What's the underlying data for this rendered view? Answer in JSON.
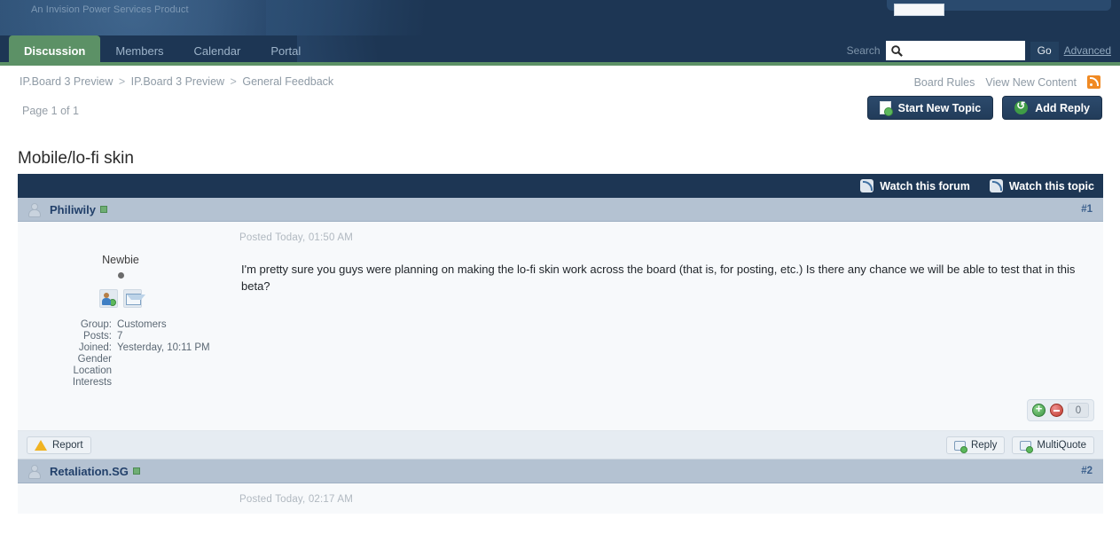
{
  "header": {
    "tagline": "An Invision Power Services Product"
  },
  "nav": {
    "tabs": [
      {
        "label": "Discussion",
        "active": true
      },
      {
        "label": "Members",
        "active": false
      },
      {
        "label": "Calendar",
        "active": false
      },
      {
        "label": "Portal",
        "active": false
      }
    ],
    "search": {
      "label": "Search",
      "value": "",
      "placeholder": "",
      "icon": "search-icon",
      "go_label": "Go",
      "advanced_label": "Advanced"
    }
  },
  "breadcrumb": {
    "items": [
      "IP.Board 3 Preview",
      "IP.Board 3 Preview",
      "General Feedback"
    ],
    "separator": ">"
  },
  "header_links": {
    "board_rules": "Board Rules",
    "view_new_content": "View New Content",
    "rss_icon": "rss-icon"
  },
  "page": {
    "page_info": "Page 1 of 1",
    "topic_title": "Mobile/lo-fi skin",
    "buttons": [
      {
        "label": "Start New Topic",
        "icon": "new-topic-icon"
      },
      {
        "label": "Add Reply",
        "icon": "reply-arrow-icon"
      }
    ]
  },
  "watch_bar": {
    "watch_forum": "Watch this forum",
    "watch_topic": "Watch this topic"
  },
  "posts": [
    {
      "author": "Philiwily",
      "number": "#1",
      "date": "Posted Today, 01:50 AM",
      "text": "I'm pretty sure you guys were planning on making the lo-fi skin work across the board (that is, for posting, etc.) Is there any chance we will be able to test that in this beta?",
      "rank": "Newbie",
      "fields": [
        {
          "label": "Group:",
          "value": "Customers"
        },
        {
          "label": "Posts:",
          "value": "7"
        },
        {
          "label": "Joined:",
          "value": "Yesterday, 10:11 PM"
        },
        {
          "label": "Gender",
          "value": ""
        },
        {
          "label": "Location",
          "value": ""
        },
        {
          "label": "Interests",
          "value": ""
        }
      ],
      "rating": "0",
      "footer": {
        "report": "Report",
        "reply": "Reply",
        "multiquote": "MultiQuote"
      }
    },
    {
      "author": "Retaliation.SG",
      "number": "#2",
      "date": "Posted Today, 02:17 AM"
    }
  ],
  "colors": {
    "header_bg": "#1d3654",
    "nav_accent": "#5c9166",
    "post_header_bg": "#b4c2d2",
    "post_body_bg": "#f7f9fb",
    "link_blue": "#22406a",
    "rss_orange": "#f08a24"
  }
}
